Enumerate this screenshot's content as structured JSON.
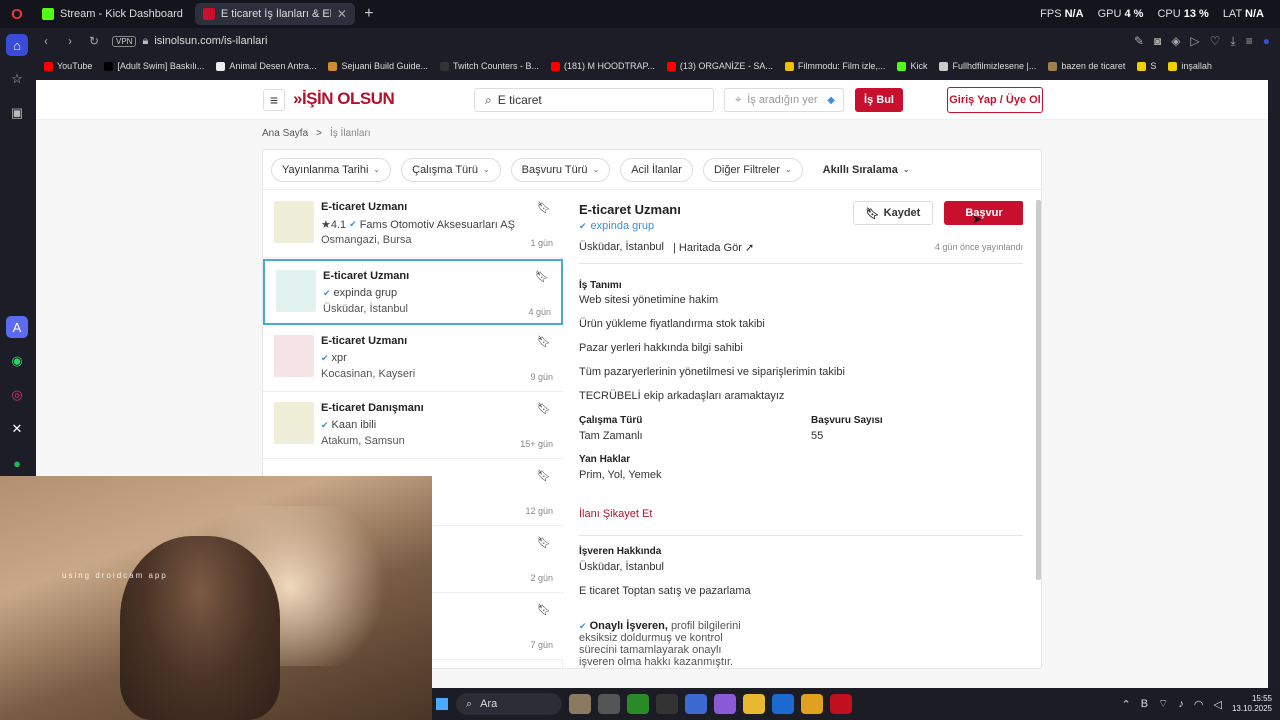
{
  "browser": {
    "tabs": [
      {
        "label": "Stream - Kick Dashboard",
        "color": "#53fc18"
      },
      {
        "label": "E ticaret İş İlanları & Elem",
        "color": "#c8102e"
      }
    ],
    "stats": {
      "fps_label": "FPS",
      "fps": "N/A",
      "gpu_label": "GPU",
      "gpu": "4 %",
      "cpu_label": "CPU",
      "cpu": "13 %",
      "lat_label": "LAT",
      "lat": "N/A"
    },
    "vpn": "VPN",
    "url": "isinolsun.com/is-ilanlari",
    "bookmarks": [
      {
        "label": "YouTube",
        "color": "#ff0000"
      },
      {
        "label": "[Adult Swim] Baskılı...",
        "color": "#000000"
      },
      {
        "label": "Animal Desen Antra...",
        "color": "#eeeeee"
      },
      {
        "label": "Sejuani Build Guide...",
        "color": "#d08a30"
      },
      {
        "label": "Twitch Counters - B...",
        "color": "#333333"
      },
      {
        "label": "(181) M HOODTRAP...",
        "color": "#ff0000"
      },
      {
        "label": "(13) ORGANİZE - SA...",
        "color": "#ff0000"
      },
      {
        "label": "Filmmodu: Film izle,...",
        "color": "#f0c000"
      },
      {
        "label": "Kick",
        "color": "#53fc18"
      },
      {
        "label": "Fullhdfilmizlesene |...",
        "color": "#cccccc"
      },
      {
        "label": "bazen de ticaret",
        "color": "#a08050"
      },
      {
        "label": "S",
        "color": "#f0d000"
      },
      {
        "label": "inşallah",
        "color": "#f0d000"
      }
    ]
  },
  "site": {
    "logo": "»İŞİN OLSUN",
    "search_value": "E ticaret",
    "location_placeholder": "İş aradığın yer",
    "find_button": "İş Bul",
    "login_button": "Giriş Yap / Üye Ol",
    "breadcrumb": {
      "home": "Ana Sayfa",
      "sep": ">",
      "current": "İş İlanları"
    },
    "filters": [
      "Yayınlanma Tarihi",
      "Çalışma Türü",
      "Başvuru Türü",
      "Acil İlanlar",
      "Diğer Filtreler"
    ],
    "sort": "Akıllı Sıralama",
    "jobs": [
      {
        "title": "E-ticaret Uzmanı",
        "rating": "★4.1",
        "company": "Fams Otomotiv Aksesuarları AŞ",
        "location": "Osmangazi, Bursa",
        "time": "1 gün",
        "thumb": "#efeed9"
      },
      {
        "title": "E-ticaret Uzmanı",
        "rating": "",
        "company": "expinda grup",
        "location": "Üsküdar, İstanbul",
        "time": "4 gün",
        "thumb": "#e2f3ef"
      },
      {
        "title": "E-ticaret Uzmanı",
        "rating": "",
        "company": "xpr",
        "location": "Kocasinan, Kayseri",
        "time": "9 gün",
        "thumb": "#f6e3e6"
      },
      {
        "title": "E-ticaret Danışmanı",
        "rating": "",
        "company": "Kaan ibili",
        "location": "Atakum, Samsun",
        "time": "15+ gün",
        "thumb": "#efeed9"
      },
      {
        "title": "",
        "rating": "",
        "company": "",
        "location": "",
        "time": "12 gün",
        "thumb": "#ffffff"
      },
      {
        "title": "",
        "rating": "",
        "company": "",
        "location": "",
        "time": "2 gün",
        "thumb": "#ffffff"
      },
      {
        "title": "",
        "rating": "",
        "company": "",
        "location": "",
        "time": "7 gün",
        "thumb": "#ffffff"
      }
    ],
    "detail": {
      "title": "E-ticaret Uzmanı",
      "company": "expinda grup",
      "location": "Üsküdar, İstanbul",
      "map_link": "Haritada Gör",
      "posted": "4 gün önce yayınlandı",
      "save_button": "Kaydet",
      "apply_button": "Başvur",
      "desc_heading": "İş Tanımı",
      "desc_lines": [
        "Web sitesi yönetimine hakim",
        "Ürün yükleme fiyatlandırma stok takibi",
        "Pazar yerleri hakkında bilgi sahibi",
        "Tüm pazaryerlerinin yönetilmesi ve siparişlerimin takibi",
        "TECRÜBELİ ekip arkadaşları aramaktayız"
      ],
      "work_type_label": "Çalışma Türü",
      "work_type": "Tam Zamanlı",
      "applicants_label": "Başvuru Sayısı",
      "applicants": "55",
      "benefits_label": "Yan Haklar",
      "benefits": "Prim, Yol, Yemek",
      "report": "İlanı Şikayet Et",
      "employer_heading": "İşveren Hakkında",
      "employer_location": "Üsküdar, İstanbul",
      "employer_desc": "E ticaret Toptan satış ve pazarlama",
      "verified_bold": "Onaylı İşveren,",
      "verified_text": "profil bilgilerini eksiksiz doldurmuş ve kontrol sürecini tamamlayarak onaylı işveren olma hakkı kazanmıştır."
    }
  },
  "webcam": {
    "watermark": "using droidcam app"
  },
  "taskbar": {
    "search_label": "Ara",
    "time": "15:55",
    "date": "13.10.2025"
  }
}
